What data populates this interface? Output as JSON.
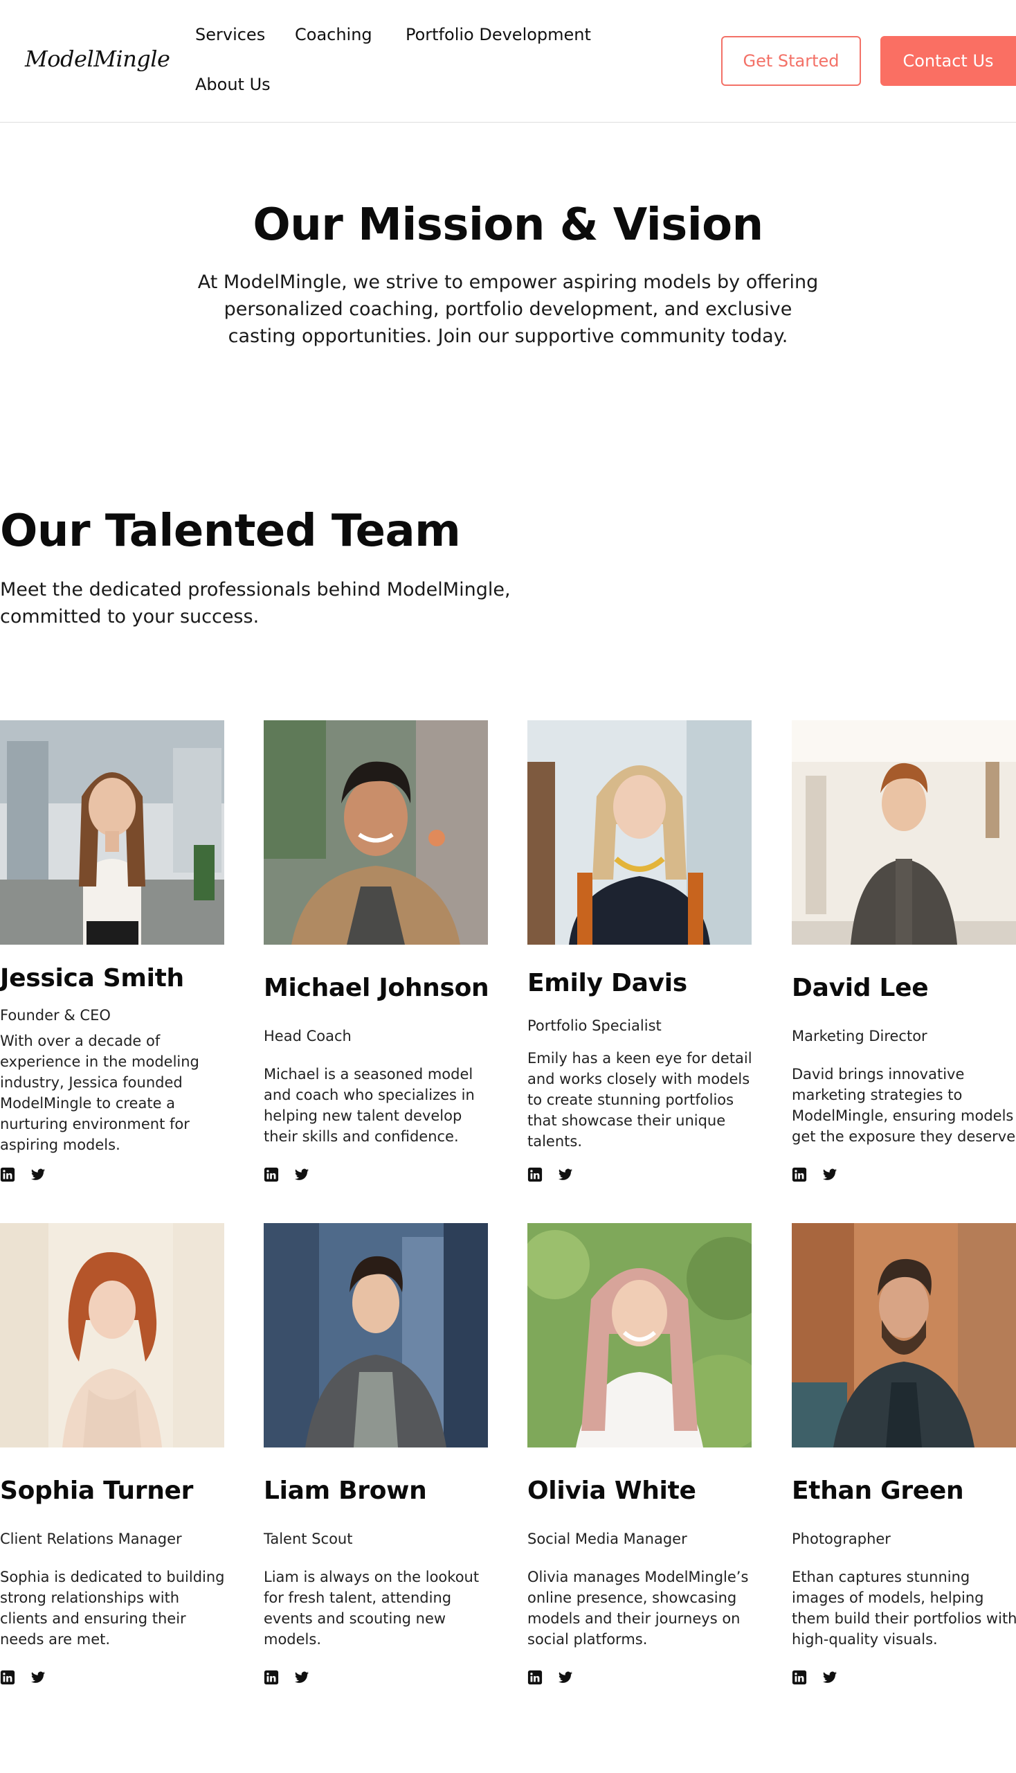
{
  "brand": {
    "logo": "ModelMingle"
  },
  "nav": {
    "items": [
      "Services",
      "Coaching",
      "Portfolio Development",
      "About Us"
    ],
    "get_started": "Get Started",
    "contact": "Contact Us"
  },
  "mission": {
    "title": "Our Mission & Vision",
    "text": "At ModelMingle, we strive to empower aspiring models by offering personalized coaching, portfolio development, and exclusive casting opportunities. Join our supportive community today."
  },
  "team": {
    "title": "Our Talented Team",
    "subtitle": "Meet the dedicated professionals behind ModelMingle, committed to your success.",
    "members": [
      {
        "name": "Jessica Smith",
        "role": "Founder & CEO",
        "bio": "With over a decade of experience in the modeling industry, Jessica founded ModelMingle to create a nurturing environment for aspiring models."
      },
      {
        "name": "Michael Johnson",
        "role": "Head Coach",
        "bio": "Michael is a seasoned model and coach who specializes in helping new talent develop their skills and confidence."
      },
      {
        "name": "Emily Davis",
        "role": "Portfolio Specialist",
        "bio": "Emily has a keen eye for detail and works closely with models to create stunning portfolios that showcase their unique talents."
      },
      {
        "name": "David Lee",
        "role": "Marketing Director",
        "bio": "David brings innovative marketing strategies to ModelMingle, ensuring models get the exposure they deserve."
      },
      {
        "name": "Sophia Turner",
        "role": "Client Relations Manager",
        "bio": "Sophia is dedicated to building strong relationships with clients and ensuring their needs are met."
      },
      {
        "name": "Liam Brown",
        "role": "Talent Scout",
        "bio": "Liam is always on the lookout for fresh talent, attending events and scouting new models."
      },
      {
        "name": "Olivia White",
        "role": "Social Media Manager",
        "bio": "Olivia manages ModelMingle’s online presence, showcasing models and their journeys on social platforms."
      },
      {
        "name": "Ethan Green",
        "role": "Photographer",
        "bio": "Ethan captures stunning images of models, helping them build their portfolios with high-quality visuals."
      }
    ]
  },
  "icons": {
    "linkedin": "linkedin-icon",
    "twitter": "twitter-icon"
  },
  "colors": {
    "accent": "#fa6f63",
    "text": "#111111",
    "divider": "#dedede"
  }
}
